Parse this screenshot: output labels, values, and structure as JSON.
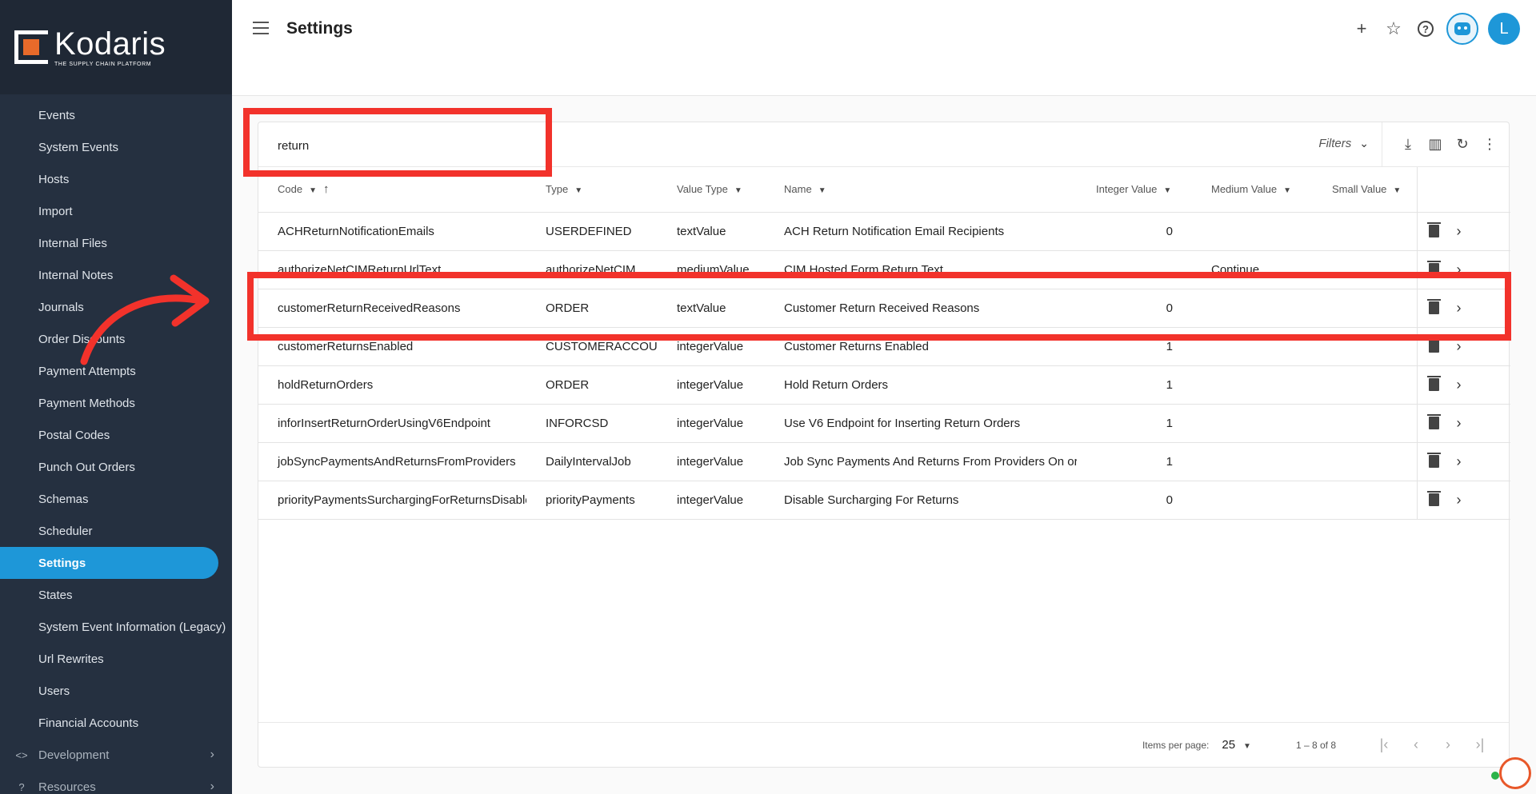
{
  "brand": {
    "name": "Kodaris",
    "tagline": "THE SUPPLY CHAIN PLATFORM",
    "accent_color": "#1e97d8",
    "logo_color": "#e86a2a"
  },
  "sidebar": {
    "items": [
      {
        "label": "Events"
      },
      {
        "label": "System Events"
      },
      {
        "label": "Hosts"
      },
      {
        "label": "Import"
      },
      {
        "label": "Internal Files"
      },
      {
        "label": "Internal Notes"
      },
      {
        "label": "Journals"
      },
      {
        "label": "Order Discounts"
      },
      {
        "label": "Payment Attempts"
      },
      {
        "label": "Payment Methods"
      },
      {
        "label": "Postal Codes"
      },
      {
        "label": "Punch Out Orders"
      },
      {
        "label": "Schemas"
      },
      {
        "label": "Scheduler"
      },
      {
        "label": "Settings",
        "active": true
      },
      {
        "label": "States"
      },
      {
        "label": "System Event Information (Legacy)"
      },
      {
        "label": "Url Rewrites"
      },
      {
        "label": "Users"
      },
      {
        "label": "Financial Accounts"
      }
    ],
    "groups": [
      {
        "label": "Development",
        "icon": "code-icon"
      },
      {
        "label": "Resources",
        "icon": "help-circle-icon"
      }
    ]
  },
  "header": {
    "title": "Settings",
    "avatar_initial": "L"
  },
  "search": {
    "value": "return"
  },
  "toolbar": {
    "filters_label": "Filters"
  },
  "table": {
    "columns": {
      "code": "Code",
      "type": "Type",
      "value_type": "Value Type",
      "name": "Name",
      "integer_value": "Integer Value",
      "medium_value": "Medium Value",
      "small_value": "Small Value"
    },
    "rows": [
      {
        "code": "ACHReturnNotificationEmails",
        "type": "USERDEFINED",
        "value_type": "textValue",
        "name": "ACH Return Notification Email Recipients",
        "integer_value": "0",
        "medium_value": "",
        "small_value": ""
      },
      {
        "code": "authorizeNetCIMReturnUrlText",
        "type": "authorizeNetCIM",
        "value_type": "mediumValue",
        "name": "CIM Hosted Form Return Text",
        "integer_value": "",
        "medium_value": "Continue",
        "small_value": ""
      },
      {
        "code": "customerReturnReceivedReasons",
        "type": "ORDER",
        "value_type": "textValue",
        "name": "Customer Return Received Reasons",
        "integer_value": "0",
        "medium_value": "",
        "small_value": ""
      },
      {
        "code": "customerReturnsEnabled",
        "type": "CUSTOMERACCOUNT",
        "value_type": "integerValue",
        "name": "Customer Returns Enabled",
        "integer_value": "1",
        "medium_value": "",
        "small_value": ""
      },
      {
        "code": "holdReturnOrders",
        "type": "ORDER",
        "value_type": "integerValue",
        "name": "Hold Return Orders",
        "integer_value": "1",
        "medium_value": "",
        "small_value": ""
      },
      {
        "code": "inforInsertReturnOrderUsingV6Endpoint",
        "type": "INFORCSD",
        "value_type": "integerValue",
        "name": "Use V6 Endpoint for Inserting Return Orders",
        "integer_value": "1",
        "medium_value": "",
        "small_value": ""
      },
      {
        "code": "jobSyncPaymentsAndReturnsFromProviders",
        "type": "DailyIntervalJob",
        "value_type": "integerValue",
        "name": "Job Sync Payments And Returns From Providers On or Off",
        "integer_value": "1",
        "medium_value": "",
        "small_value": ""
      },
      {
        "code": "priorityPaymentsSurchargingForReturnsDisabled",
        "type": "priorityPayments",
        "value_type": "integerValue",
        "name": "Disable Surcharging For Returns",
        "integer_value": "0",
        "medium_value": "",
        "small_value": ""
      }
    ]
  },
  "paginator": {
    "items_per_page_label": "Items per page:",
    "page_size": "25",
    "range": "1 – 8 of 8"
  },
  "annotation": {
    "highlight_color": "#f2322b"
  }
}
